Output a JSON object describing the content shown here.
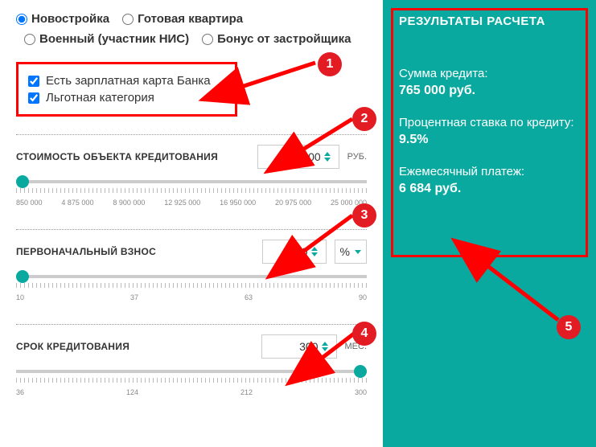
{
  "radios": {
    "new_building": "Новостройка",
    "ready_flat": "Готовая квартира",
    "military": "Военный (участник НИС)",
    "developer_bonus": "Бонус от застройщика"
  },
  "checks": {
    "salary_card": "Есть зарплатная карта Банка",
    "privileged": "Льготная категория"
  },
  "fields": {
    "cost_label": "СТОИМОСТЬ ОБЪЕКТА КРЕДИТОВАНИЯ",
    "cost_value": "850 000",
    "cost_unit": "РУБ.",
    "cost_ticks": [
      "850 000",
      "4 875 000",
      "8 900 000",
      "12 925 000",
      "16 950 000",
      "20 975 000",
      "25 000 000"
    ],
    "down_label": "ПЕРВОНАЧАЛЬНЫЙ ВЗНОС",
    "down_value": "10",
    "down_unit": "%",
    "down_ticks": [
      "10",
      "37",
      "63",
      "90"
    ],
    "term_label": "СРОК КРЕДИТОВАНИЯ",
    "term_value": "300",
    "term_unit": "МЕС.",
    "term_ticks": [
      "36",
      "124",
      "212",
      "300"
    ]
  },
  "results": {
    "title": "РЕЗУЛЬТАТЫ РАСЧЕТА",
    "loan_label": "Сумма кредита:",
    "loan_value": "765 000 руб.",
    "rate_label": "Процентная ставка по кредиту:",
    "rate_value": "9.5%",
    "monthly_label": "Ежемесячный платеж:",
    "monthly_value": "6 684 руб."
  },
  "annotations": {
    "n1": "1",
    "n2": "2",
    "n3": "3",
    "n4": "4",
    "n5": "5"
  }
}
